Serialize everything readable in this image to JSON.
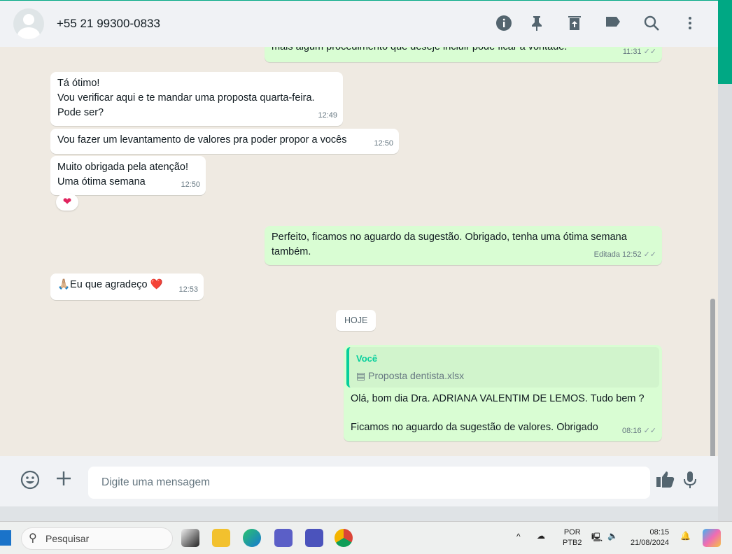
{
  "header": {
    "contact": "+55 21 99300-0833",
    "icons": [
      "info-icon",
      "pin-icon",
      "delete-icon",
      "label-icon",
      "search-icon",
      "menu-icon"
    ]
  },
  "messages": [
    {
      "dir": "out",
      "text": "mais algum procedimento que deseje incluir pode ficar a vontade.",
      "time": "11:31"
    },
    {
      "dir": "in",
      "lines": [
        "Tá ótimo!",
        "Vou verificar aqui e te mandar uma proposta quarta-feira.",
        "Pode ser?"
      ],
      "time": "12:49"
    },
    {
      "dir": "in",
      "text": "Vou fazer um levantamento de valores pra poder propor a vocês",
      "time": "12:50"
    },
    {
      "dir": "in",
      "lines": [
        "Muito obrigada pela atenção!",
        "Uma ótima semana"
      ],
      "time": "12:50",
      "reaction": "❤"
    },
    {
      "dir": "out",
      "lines": [
        "Perfeito, ficamos no aguardo da sugestão. Obrigado, tenha uma ótima semana",
        "também."
      ],
      "edited": "Editada",
      "time": "12:52"
    },
    {
      "dir": "in",
      "text": "🙏🏼Eu que agradeço ❤️",
      "time": "12:53"
    },
    {
      "dir": "out",
      "quote_author": "Você",
      "quote_file": "Proposta dentista.xlsx",
      "lines": [
        "Olá, bom dia Dra. ADRIANA VALENTIM DE LEMOS. Tudo bem ?",
        "Ficamos no aguardo da sugestão de valores. Obrigado"
      ],
      "time": "08:16"
    }
  ],
  "date_chip": "HOJE",
  "footer": {
    "placeholder": "Digite uma mensagem"
  },
  "taskbar": {
    "search": "Pesquisar",
    "lang1": "POR",
    "lang2": "PTB2",
    "time": "08:15",
    "date": "21/08/2024"
  }
}
